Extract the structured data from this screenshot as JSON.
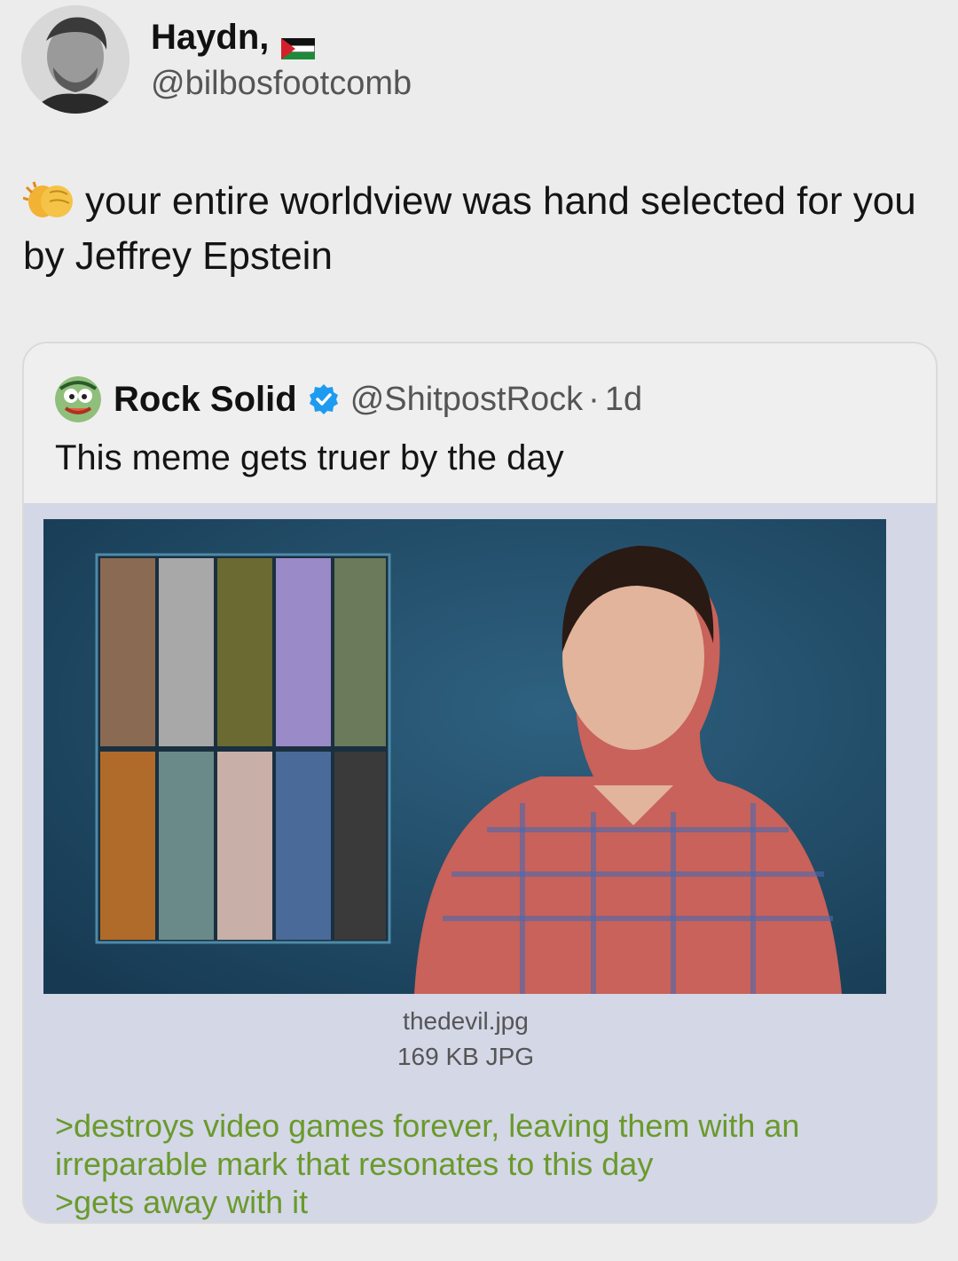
{
  "tweet": {
    "author": {
      "display_name": "Haydn,",
      "handle": "@bilbosfootcomb",
      "avatar_icon": "profile-photo",
      "flag_icon": "palestine-flag-icon"
    },
    "emoji_icon": "clapping-hands-emoji",
    "text": "your entire worldview was hand selected for you by Jeffrey Epstein"
  },
  "quote": {
    "author": {
      "display_name": "Rock Solid",
      "verified_icon": "verified-badge-icon",
      "handle": "@ShitpostRock",
      "separator": "·",
      "time": "1d",
      "avatar_icon": "cartoon-face-avatar"
    },
    "text": "This meme gets truer by the day",
    "chan_post": {
      "image_icon": "meme-image",
      "file_name": "thedevil.jpg",
      "file_meta": "169 KB JPG",
      "greentext": [
        ">destroys video games forever, leaving them with an",
        "irreparable mark that resonates to this day",
        ">gets away with it"
      ]
    }
  },
  "colors": {
    "background": "#ececec",
    "card_border": "#dadada",
    "chan_background": "#d3d7e6",
    "greentext": "#6a9a2c",
    "verified_blue": "#1d9bf0"
  }
}
